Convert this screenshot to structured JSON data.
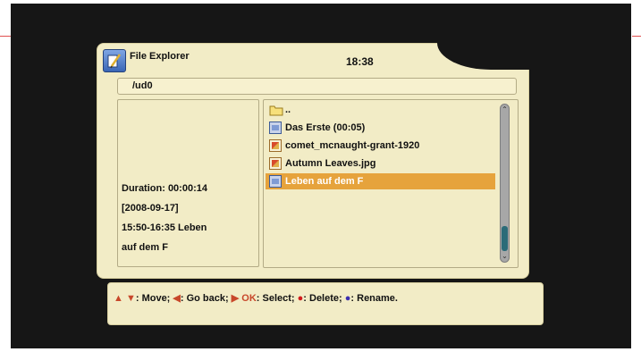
{
  "window": {
    "title": "File Explorer",
    "time": "18:38"
  },
  "path": "/ud0",
  "info": {
    "duration": "Duration: 00:00:14",
    "date": "[2008-09-17]",
    "schedule": "15:50-16:35 Leben",
    "name": "auf dem F"
  },
  "files": [
    {
      "label": "..",
      "icon": "folder-icon"
    },
    {
      "label": "Das Erste (00:05)",
      "icon": "video-file-icon"
    },
    {
      "label": "comet_mcnaught-grant-1920",
      "icon": "image-file-icon"
    },
    {
      "label": "Autumn Leaves.jpg",
      "icon": "image-file-icon"
    },
    {
      "label": "Leben auf dem F",
      "icon": "video-file-icon",
      "selected": true
    }
  ],
  "help": {
    "move": ": Move;",
    "back": ": Go back;",
    "ok": "OK",
    "select": ": Select;",
    "delete": ": Delete;",
    "rename": ": Rename."
  },
  "colors": {
    "panel": "#f2ecc6",
    "selection": "#e6a33c",
    "background": "#161616"
  }
}
